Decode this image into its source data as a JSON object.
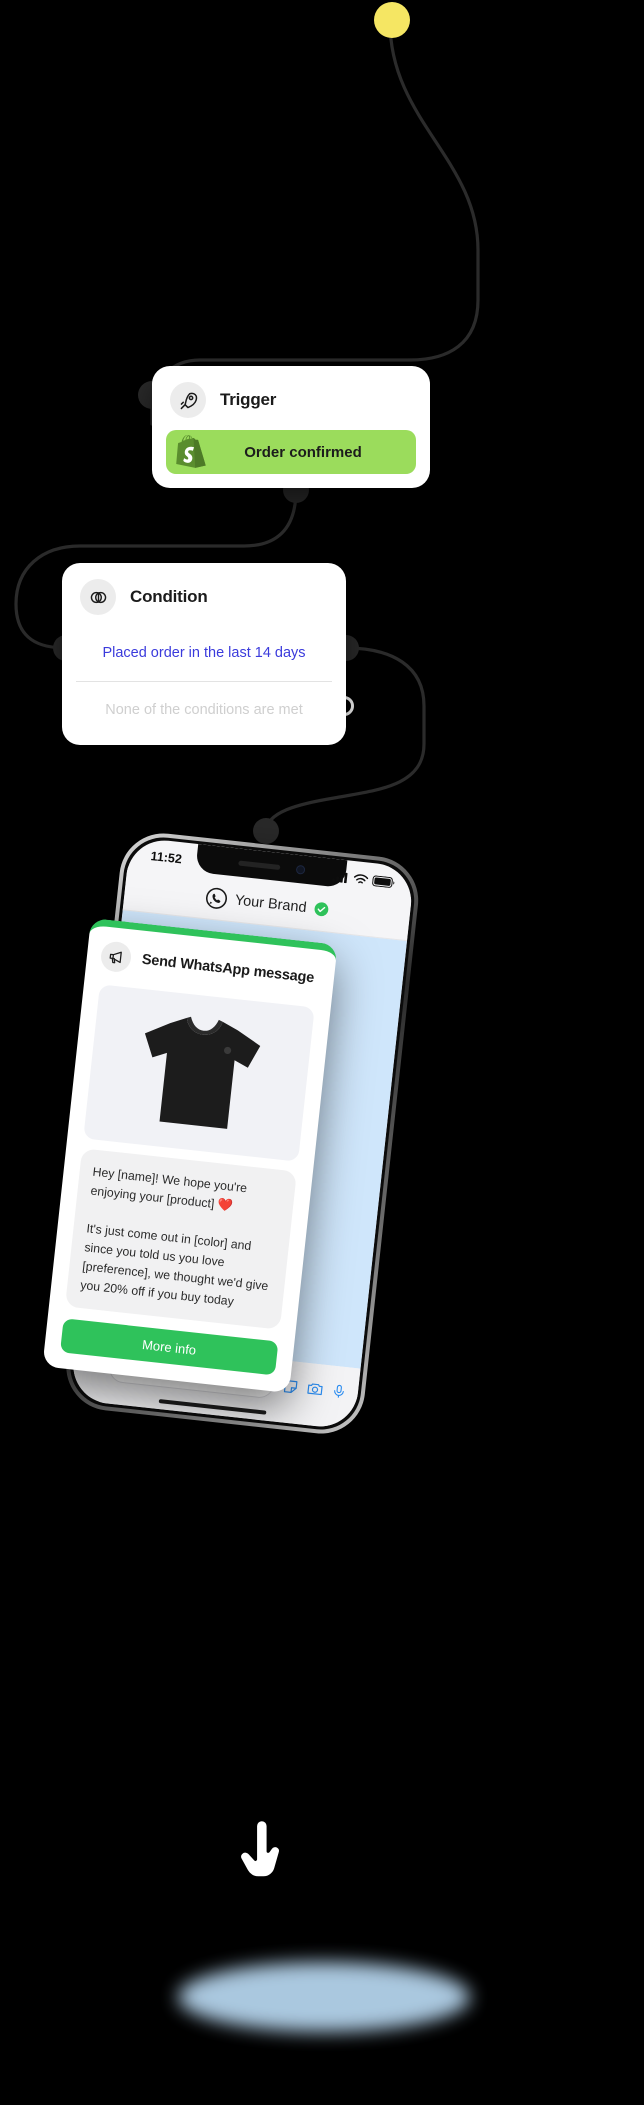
{
  "theme": {
    "background": "#000000",
    "wire_color": "#2b2b2b",
    "accent_green": "#2fc25b",
    "shopify_green": "#9bdc5c",
    "condition_met_color": "#3b3bdc",
    "condition_unmet_color": "#cfcfcf",
    "whatsapp_bg": "#cfe6fb",
    "ground_shadow": "#b9d9f2",
    "start_dot_color": "#f5e663"
  },
  "flow": {
    "trigger": {
      "icon": "rocket-icon",
      "title": "Trigger",
      "pill": {
        "icon": "shopify-icon",
        "label": "Order confirmed"
      }
    },
    "condition": {
      "icon": "venn-diagram-icon",
      "title": "Condition",
      "rows": [
        {
          "label": "Placed order in the last 14 days",
          "state": "met"
        },
        {
          "label": "None of the conditions are met",
          "state": "unmet"
        }
      ]
    },
    "action": {
      "icon": "megaphone-icon",
      "title": "Send WhatsApp message",
      "product_image_alt": "black-tshirt",
      "message": "Hey [name]! We hope you're enjoying your [product] ❤️\n\nIt's just come out in [color] and since you told us you love [preference], we thought we'd give you 20% off if you buy today",
      "cta_label": "More info"
    }
  },
  "phone": {
    "status": {
      "time": "11:52",
      "signal_icon": "cellular-bars-icon",
      "wifi_icon": "wifi-icon",
      "battery_icon": "battery-icon"
    },
    "chat_header": {
      "avatar_icon": "whatsapp-icon",
      "brand_name": "Your Brand",
      "verified_icon": "verified-check-icon"
    },
    "input_bar": {
      "add_icon": "plus-icon",
      "placeholder": "",
      "sticker_icon": "sticker-icon",
      "camera_icon": "camera-icon",
      "mic_icon": "microphone-icon"
    },
    "home_indicator": "home-indicator"
  }
}
